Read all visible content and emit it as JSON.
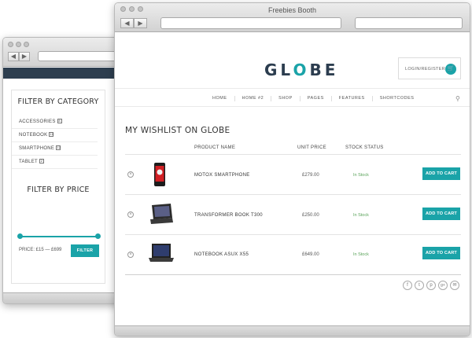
{
  "back_window": {
    "filter_category_title": "FILTER BY CATEGORY",
    "categories": [
      {
        "label": "ACCESSORIES",
        "count": "8"
      },
      {
        "label": "NOTEBOOK",
        "count": "10"
      },
      {
        "label": "SMARTPHONE",
        "count": "12"
      },
      {
        "label": "TABLET",
        "count": "2"
      }
    ],
    "filter_price_title": "FILTER BY PRICE",
    "price_range": "PRICE: £15 — £699",
    "filter_button": "FILTER"
  },
  "front_window": {
    "title": "Freebies Booth",
    "logo": {
      "part1": "GL",
      "part2": "O",
      "part3": "BE"
    },
    "login_label": "LOGIN/REGISTER",
    "menu": [
      "HOME",
      "HOME #2",
      "SHOP",
      "PAGES",
      "FEATURES",
      "SHORTCODES"
    ],
    "heading": "MY WISHLIST ON GLOBE",
    "columns": {
      "product": "PRODUCT NAME",
      "price": "UNIT PRICE",
      "stock": "STOCK STATUS"
    },
    "rows": [
      {
        "name": "MOTOX SMARTPHONE",
        "price": "£279.00",
        "stock": "In Stock",
        "action": "ADD TO CART",
        "icon": "phone-icon"
      },
      {
        "name": "TRANSFORMER BOOK T300",
        "price": "£250.00",
        "stock": "In Stock",
        "action": "ADD TO CART",
        "icon": "tablet-icon"
      },
      {
        "name": "NOTEBOOK ASUX X55",
        "price": "£649.00",
        "stock": "In Stock",
        "action": "ADD TO CART",
        "icon": "laptop-icon"
      }
    ],
    "social": [
      {
        "glyph": "f",
        "icon": "facebook-icon"
      },
      {
        "glyph": "t",
        "icon": "twitter-icon"
      },
      {
        "glyph": "p",
        "icon": "pinterest-icon"
      },
      {
        "glyph": "g+",
        "icon": "googleplus-icon"
      },
      {
        "glyph": "✉",
        "icon": "email-icon"
      }
    ],
    "colors": {
      "accent": "#1aa3a8",
      "logo": "#2c3d4f",
      "stock": "#5aa35a"
    }
  }
}
